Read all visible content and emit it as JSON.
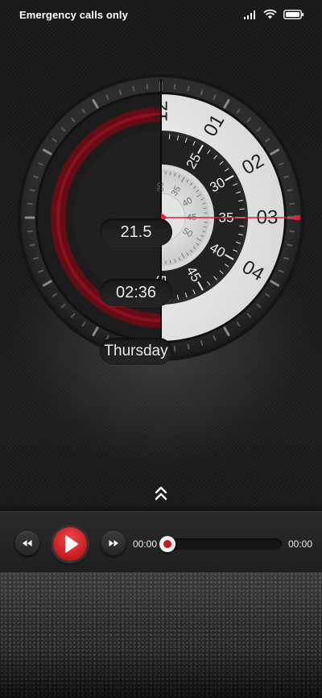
{
  "status_bar": {
    "carrier_text": "Emergency calls only",
    "icons": [
      "signal-icon",
      "wifi-icon",
      "battery-icon"
    ]
  },
  "watch": {
    "temperature": "21.5",
    "time": "02:36",
    "day": "Thursday",
    "hour_ring": [
      "12",
      "01",
      "02",
      "03",
      "04"
    ],
    "minute_ring": [
      "25",
      "30",
      "35",
      "40",
      "45",
      "50"
    ],
    "second_ring": [
      "30",
      "35",
      "40",
      "45",
      "50"
    ],
    "accent_color": "#e0213a"
  },
  "player": {
    "elapsed": "00:00",
    "total": "00:00",
    "progress": 0,
    "icons": {
      "rewind": "rewind-icon",
      "play": "play-icon",
      "forward": "fast-forward-icon"
    },
    "accent_color": "#c41a1f"
  },
  "swipe_hint_icon": "double-chevron-up-icon"
}
